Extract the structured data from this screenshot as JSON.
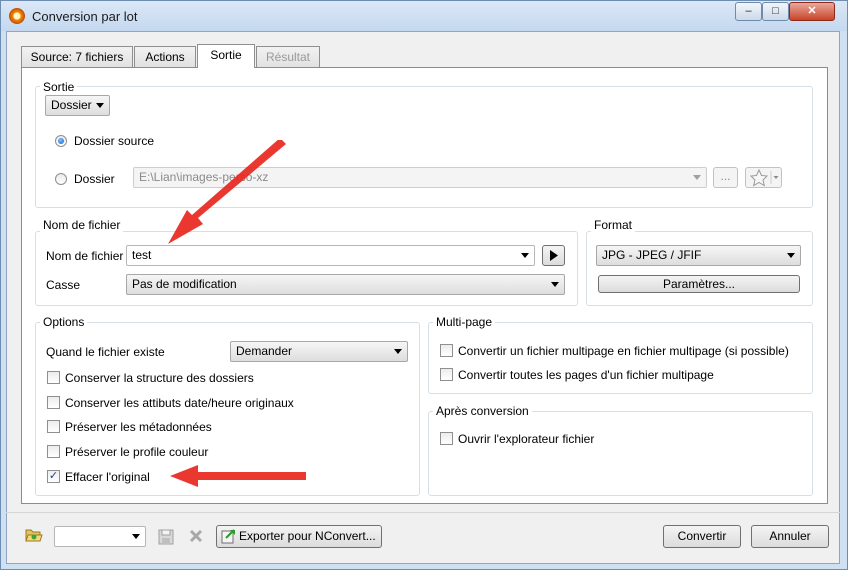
{
  "window": {
    "title": "Conversion par lot",
    "controls": [
      "–",
      "□",
      "✕"
    ]
  },
  "tabs": [
    {
      "label": "Source: 7 fichiers",
      "active": false
    },
    {
      "label": "Actions",
      "active": false
    },
    {
      "label": "Sortie",
      "active": true
    },
    {
      "label": "Résultat",
      "active": false,
      "disabled": true
    }
  ],
  "sortie": {
    "group_title": "Sortie",
    "mode": "Dossier",
    "radio_source_label": "Dossier source",
    "radio_folder_label": "Dossier",
    "folder_path": "E:\\Lian\\images-perso-xz",
    "browse_label": "..."
  },
  "nom_fichier": {
    "group_title": "Nom de fichier",
    "name_label": "Nom de fichier",
    "name_value": "test",
    "case_label": "Casse",
    "case_value": "Pas de modification"
  },
  "format": {
    "group_title": "Format",
    "value": "JPG - JPEG / JFIF",
    "params_label": "Paramètres..."
  },
  "options": {
    "group_title": "Options",
    "exists_label": "Quand le fichier existe",
    "exists_value": "Demander",
    "checkboxes": [
      {
        "label": "Conserver la structure des dossiers",
        "checked": false
      },
      {
        "label": "Conserver les attibuts date/heure originaux",
        "checked": false
      },
      {
        "label": "Préserver les métadonnées",
        "checked": false
      },
      {
        "label": "Préserver le profile couleur",
        "checked": false
      },
      {
        "label": "Effacer l'original",
        "checked": true
      }
    ]
  },
  "multipage": {
    "group_title": "Multi-page",
    "checkboxes": [
      {
        "label": "Convertir un fichier multipage en fichier multipage (si possible)",
        "checked": false
      },
      {
        "label": "Convertir toutes les pages d'un fichier multipage",
        "checked": false
      }
    ]
  },
  "apres": {
    "group_title": "Après conversion",
    "checkboxes": [
      {
        "label": "Ouvrir l'explorateur fichier",
        "checked": false
      }
    ]
  },
  "footer": {
    "export_label": "Exporter pour NConvert...",
    "convert_label": "Convertir",
    "cancel_label": "Annuler"
  },
  "colors": {
    "accent_arrow": "#e8221b",
    "title_bar": "#c4d8ef",
    "panel_bg": "#ffffff",
    "group_border": "#d5dfe5"
  },
  "icons": [
    "app-icon",
    "folder-open-icon",
    "save-icon",
    "delete-icon",
    "nconvert-icon",
    "favorite-star-icon",
    "play-icon"
  ]
}
